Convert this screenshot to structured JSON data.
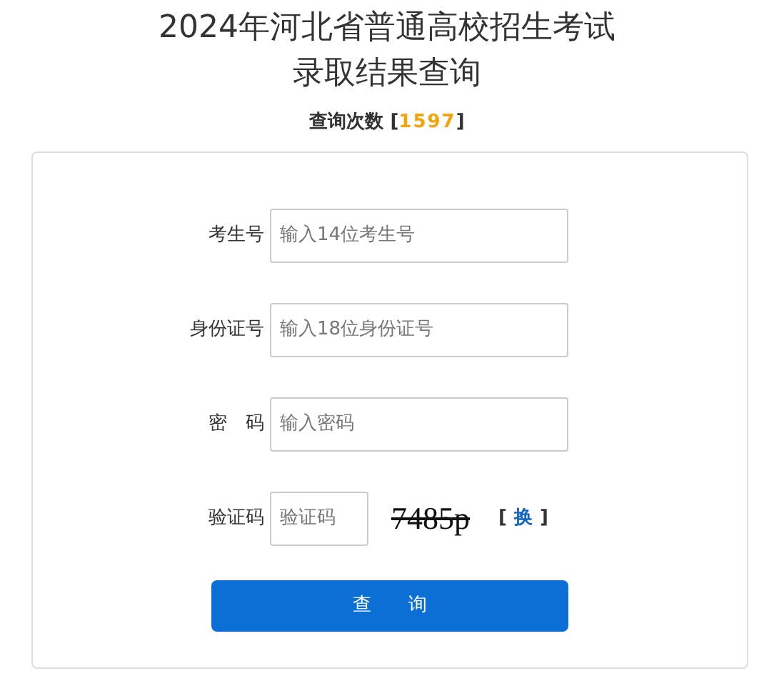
{
  "title_lines": [
    "2024年河北省普通高校招生考试",
    "录取结果查询"
  ],
  "query_count": {
    "label": "查询次数",
    "open": "[",
    "value": "1597",
    "close": "]"
  },
  "fields": [
    {
      "kind": "text",
      "label": "考生号",
      "placeholder": "输入14位考生号"
    },
    {
      "kind": "text",
      "label": "身份证号",
      "placeholder": "输入18位身份证号"
    },
    {
      "kind": "password",
      "label": "密　码",
      "placeholder": "输入密码"
    },
    {
      "kind": "captcha",
      "label": "验证码",
      "placeholder": "验证码",
      "captcha_text": "7485p",
      "refresh_open": "[",
      "refresh": "换",
      "refresh_close": "]"
    }
  ],
  "submit": "查　　询"
}
